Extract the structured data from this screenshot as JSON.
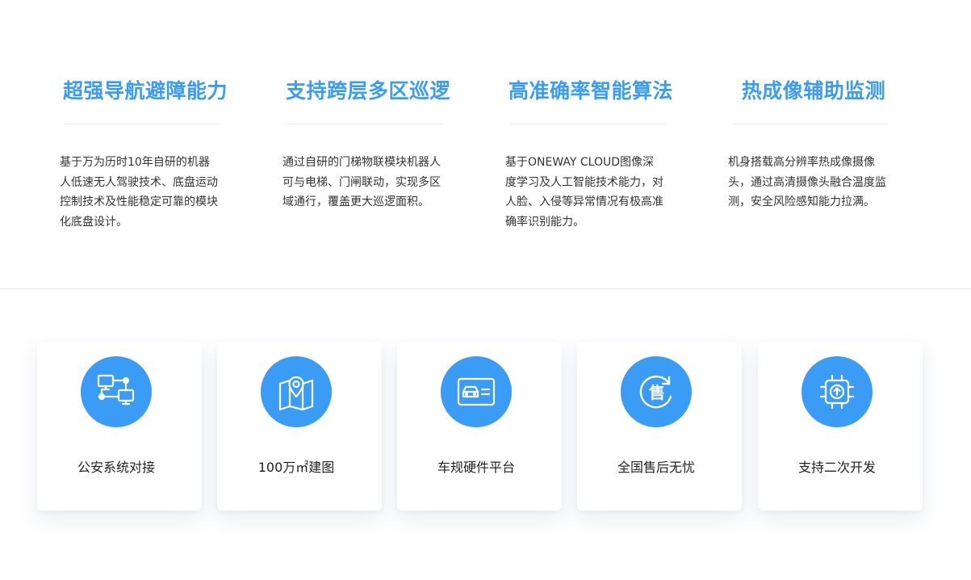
{
  "features": [
    {
      "title": "超强导航避障能力",
      "description": "基于万为历时10年自研的机器人低速无人驾驶技术、底盘运动控制技术及性能稳定可靠的模块化底盘设计。"
    },
    {
      "title": "支持跨层多区巡逻",
      "description": "通过自研的门梯物联模块机器人可与电梯、门闸联动，实现多区域通行，覆盖更大巡逻面积。"
    },
    {
      "title": "高准确率智能算法",
      "description": "基于ONEWAY CLOUD图像深度学习及人工智能技术能力，对人脸、入侵等异常情况有极高准确率识别能力。"
    },
    {
      "title": "热成像辅助监测",
      "description": "机身搭载高分辨率热成像摄像头，通过高清摄像头融合温度监测，安全风险感知能力拉满。"
    }
  ],
  "cards": [
    {
      "label": "公安系统对接",
      "icon": "network-computers-icon"
    },
    {
      "label": "100万㎡建图",
      "icon": "map-pin-icon"
    },
    {
      "label": "车规硬件平台",
      "icon": "car-card-icon"
    },
    {
      "label": "全国售后无忧",
      "icon": "after-sales-icon",
      "icon_text": "售"
    },
    {
      "label": "支持二次开发",
      "icon": "chip-upload-icon"
    }
  ],
  "colors": {
    "accent": "#3a9cf5",
    "text": "#333333",
    "background": "#ffffff"
  }
}
